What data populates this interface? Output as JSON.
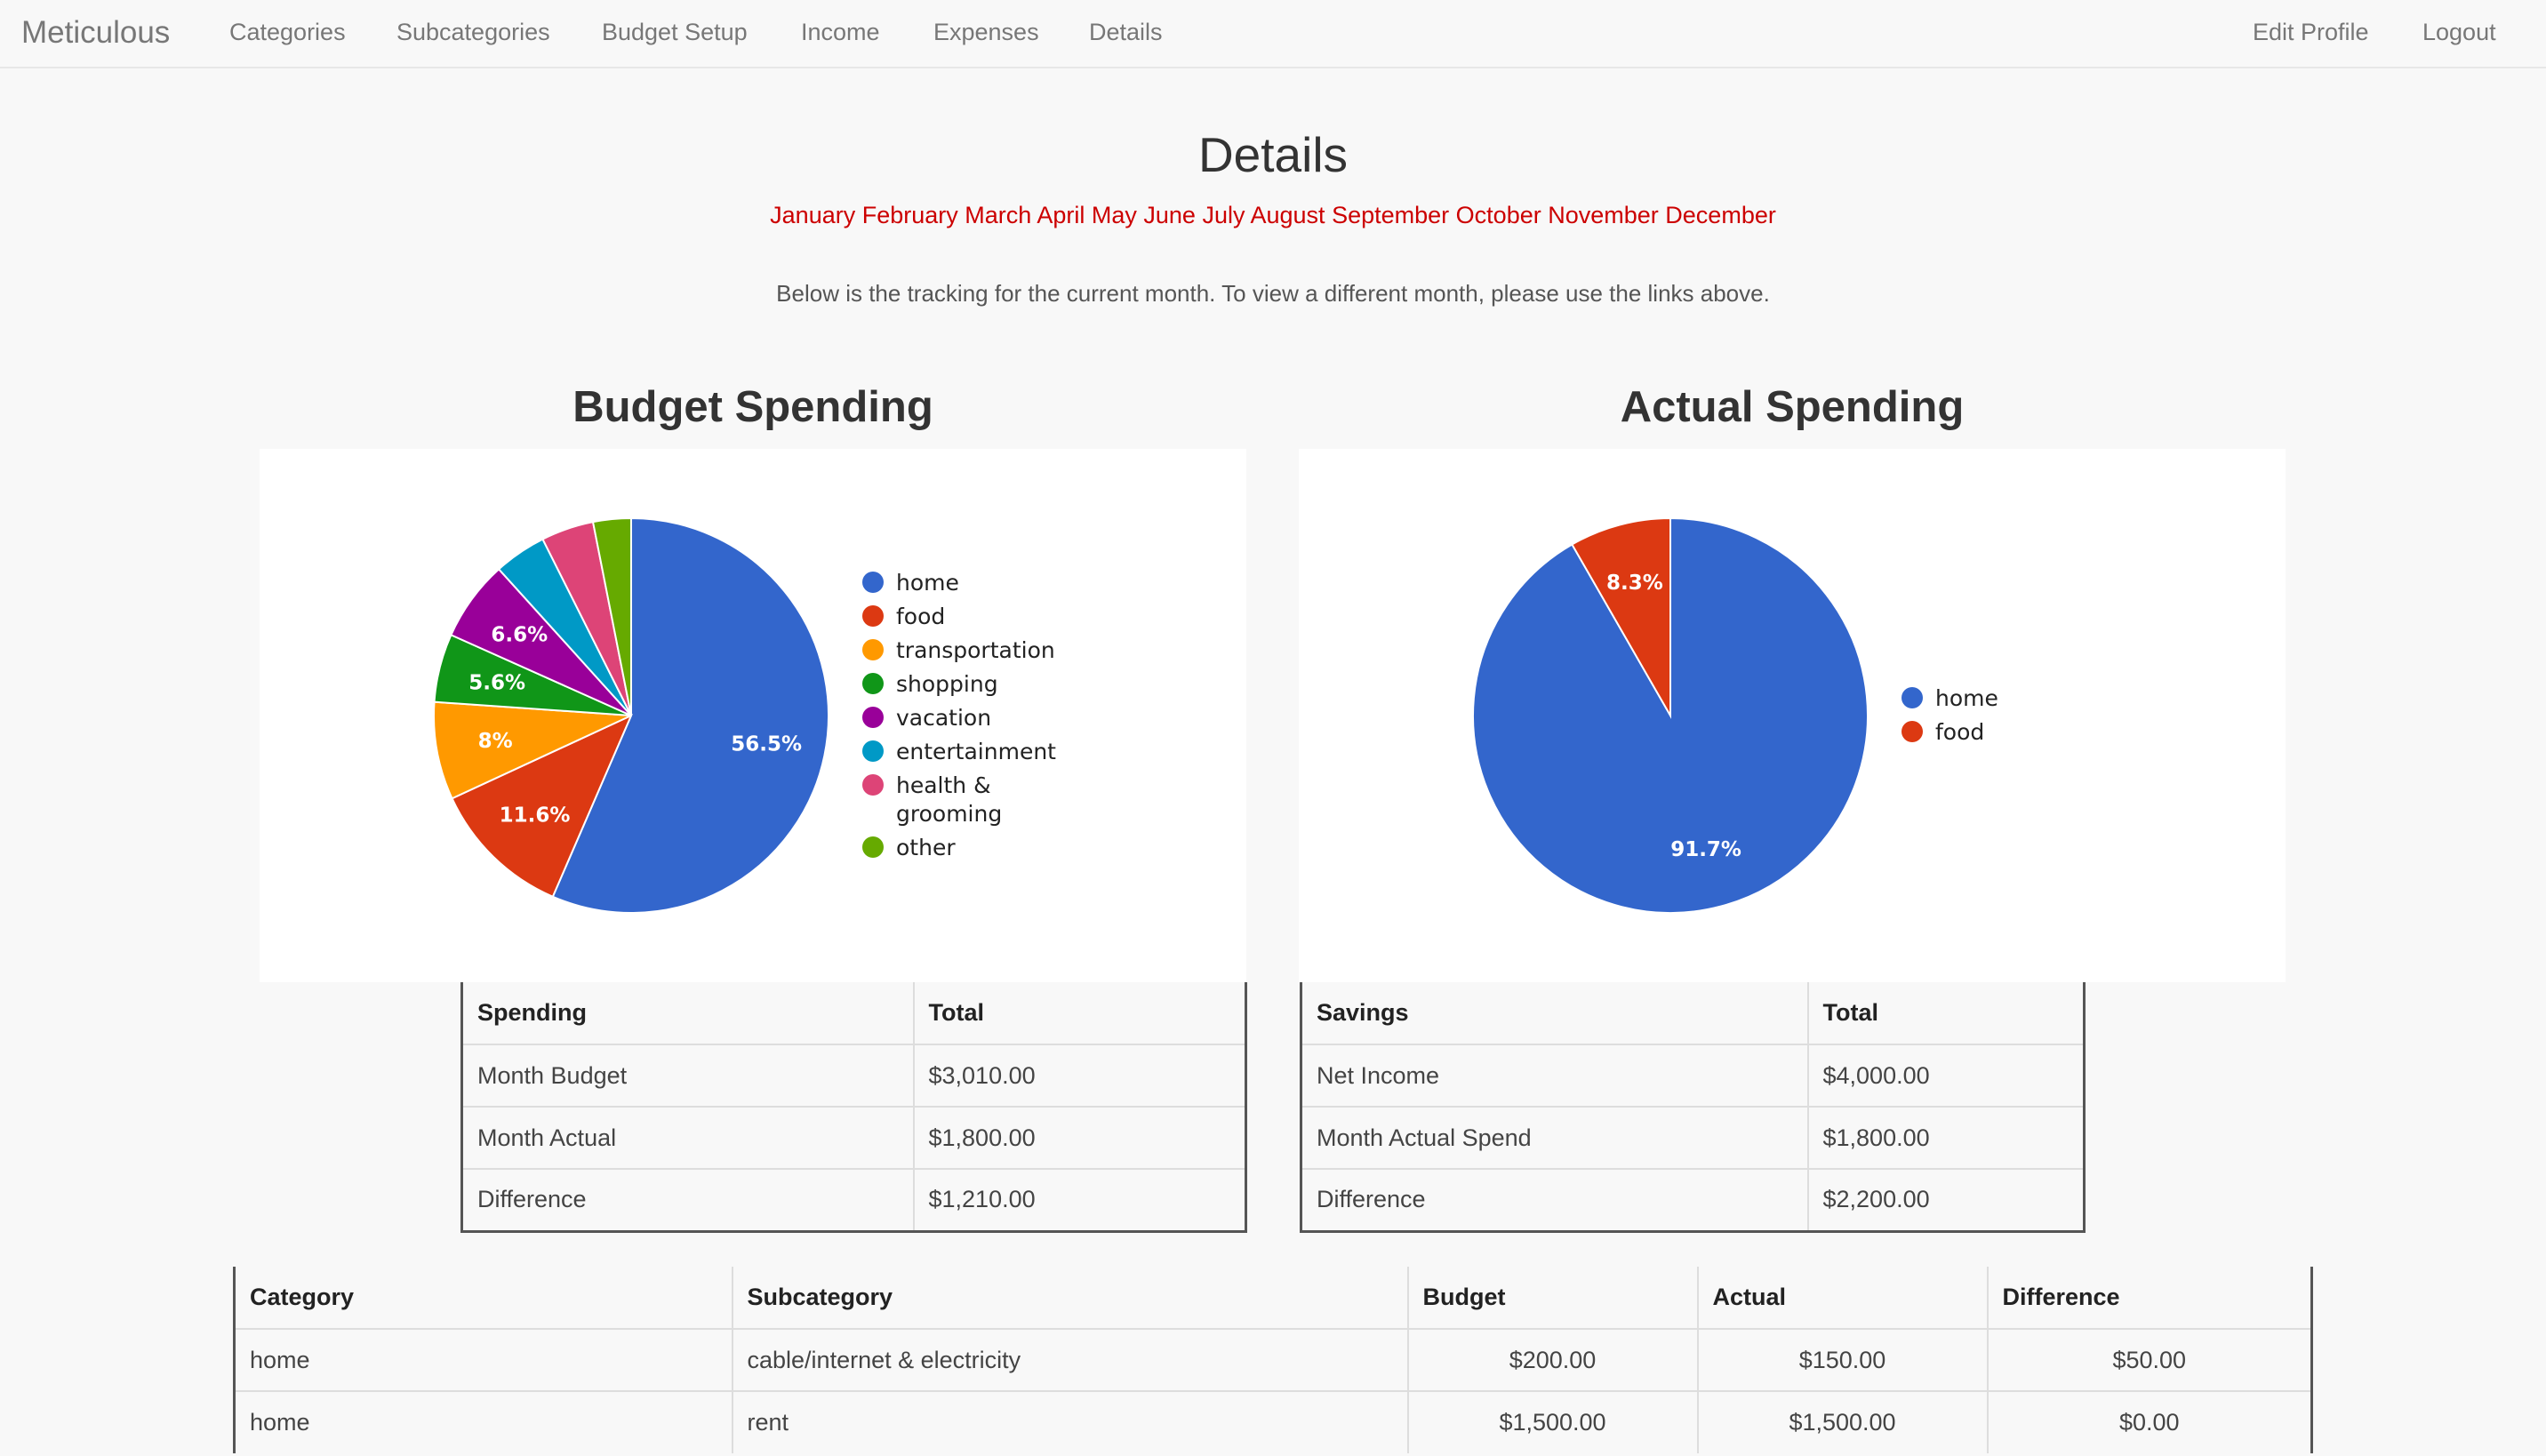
{
  "nav": {
    "brand": "Meticulous",
    "links": [
      "Categories",
      "Subcategories",
      "Budget Setup",
      "Income",
      "Expenses",
      "Details"
    ],
    "right_links": [
      "Edit Profile",
      "Logout"
    ]
  },
  "page": {
    "title": "Details",
    "months": [
      "January",
      "February",
      "March",
      "April",
      "May",
      "June",
      "July",
      "August",
      "September",
      "October",
      "November",
      "December"
    ],
    "intro": "Below is the tracking for the current month. To view a different month, please use the links above."
  },
  "chart_data": [
    {
      "type": "pie",
      "title": "Budget Spending",
      "categories": [
        "home",
        "food",
        "transportation",
        "shopping",
        "vacation",
        "entertainment",
        "health & grooming",
        "other"
      ],
      "values": [
        56.5,
        11.6,
        8.0,
        5.6,
        6.6,
        4.3,
        4.3,
        3.1
      ],
      "labels": [
        "56.5%",
        "11.6%",
        "8%",
        "5.6%",
        "6.6%",
        "",
        "",
        ""
      ],
      "colors": [
        "#3366cc",
        "#dc3912",
        "#ff9900",
        "#109618",
        "#990099",
        "#0099c6",
        "#dd4477",
        "#66aa00"
      ],
      "legend_position": "right"
    },
    {
      "type": "pie",
      "title": "Actual Spending",
      "categories": [
        "home",
        "food"
      ],
      "values": [
        91.7,
        8.3
      ],
      "labels": [
        "91.7%",
        "8.3%"
      ],
      "colors": [
        "#3366cc",
        "#dc3912"
      ],
      "legend_position": "right"
    }
  ],
  "spending_table": {
    "headers": [
      "Spending",
      "Total"
    ],
    "rows": [
      [
        "Month Budget",
        "$3,010.00"
      ],
      [
        "Month Actual",
        "$1,800.00"
      ],
      [
        "Difference",
        "$1,210.00"
      ]
    ]
  },
  "savings_table": {
    "headers": [
      "Savings",
      "Total"
    ],
    "rows": [
      [
        "Net Income",
        "$4,000.00"
      ],
      [
        "Month Actual Spend",
        "$1,800.00"
      ],
      [
        "Difference",
        "$2,200.00"
      ]
    ]
  },
  "detail_table": {
    "headers": [
      "Category",
      "Subcategory",
      "Budget",
      "Actual",
      "Difference"
    ],
    "rows": [
      [
        "home",
        "cable/internet & electricity",
        "$200.00",
        "$150.00",
        "$50.00"
      ],
      [
        "home",
        "rent",
        "$1,500.00",
        "$1,500.00",
        "$0.00"
      ]
    ]
  }
}
